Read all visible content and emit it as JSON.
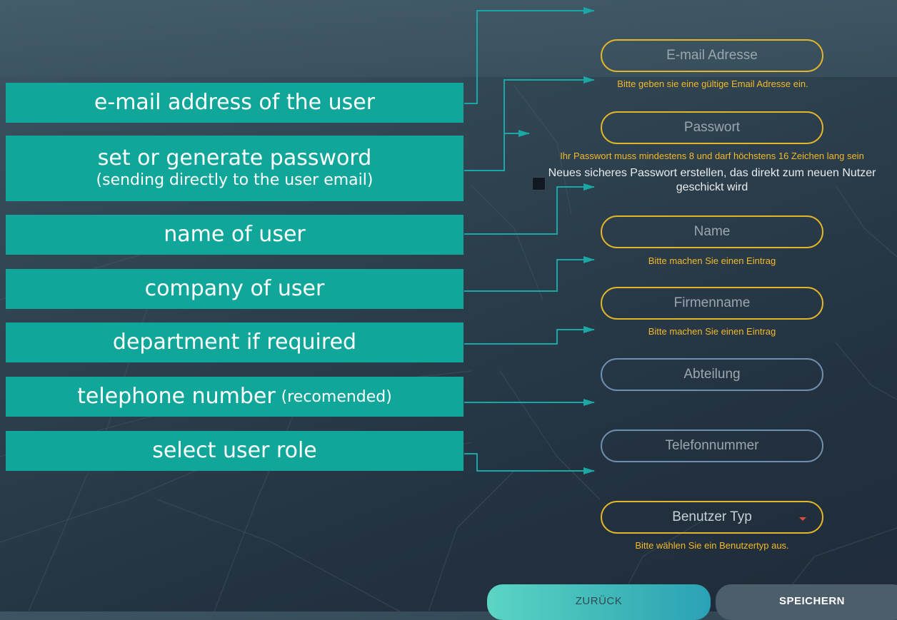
{
  "annotations": {
    "email": "e-mail address of the user",
    "password_main": "set or generate password",
    "password_sub": "(sending directly to the user email)",
    "name": "name of user",
    "company": "company of user",
    "department": "department if required",
    "telephone_main": "telephone number",
    "telephone_sub": "(recomended)",
    "role": "select user role"
  },
  "form": {
    "email_placeholder": "E-mail Adresse",
    "email_hint": "Bitte geben sie eine gültige Email Adresse ein.",
    "password_placeholder": "Passwort",
    "password_hint": "Ihr Passwort muss mindestens 8 und darf höchstens 16 Zeichen lang sein",
    "generate_checkbox_label": "Neues sicheres Passwort erstellen, das direkt zum neuen Nutzer geschickt wird",
    "name_placeholder": "Name",
    "name_hint": "Bitte machen Sie einen Eintrag",
    "company_placeholder": "Firmenname",
    "company_hint": "Bitte machen Sie einen Eintrag",
    "department_placeholder": "Abteilung",
    "telephone_placeholder": "Telefonnummer",
    "user_type_label": "Benutzer Typ",
    "user_type_hint": "Bitte wählen Sie ein Benutzertyp aus.",
    "back_button": "ZURÜCK",
    "save_button": "SPEICHERN"
  },
  "colors": {
    "annotation_bg": "#11a69a",
    "connector": "#1aa7a6",
    "field_border_required": "#e3b52a",
    "field_border_optional": "#6d8fb0",
    "hint_text": "#f2b92a"
  }
}
